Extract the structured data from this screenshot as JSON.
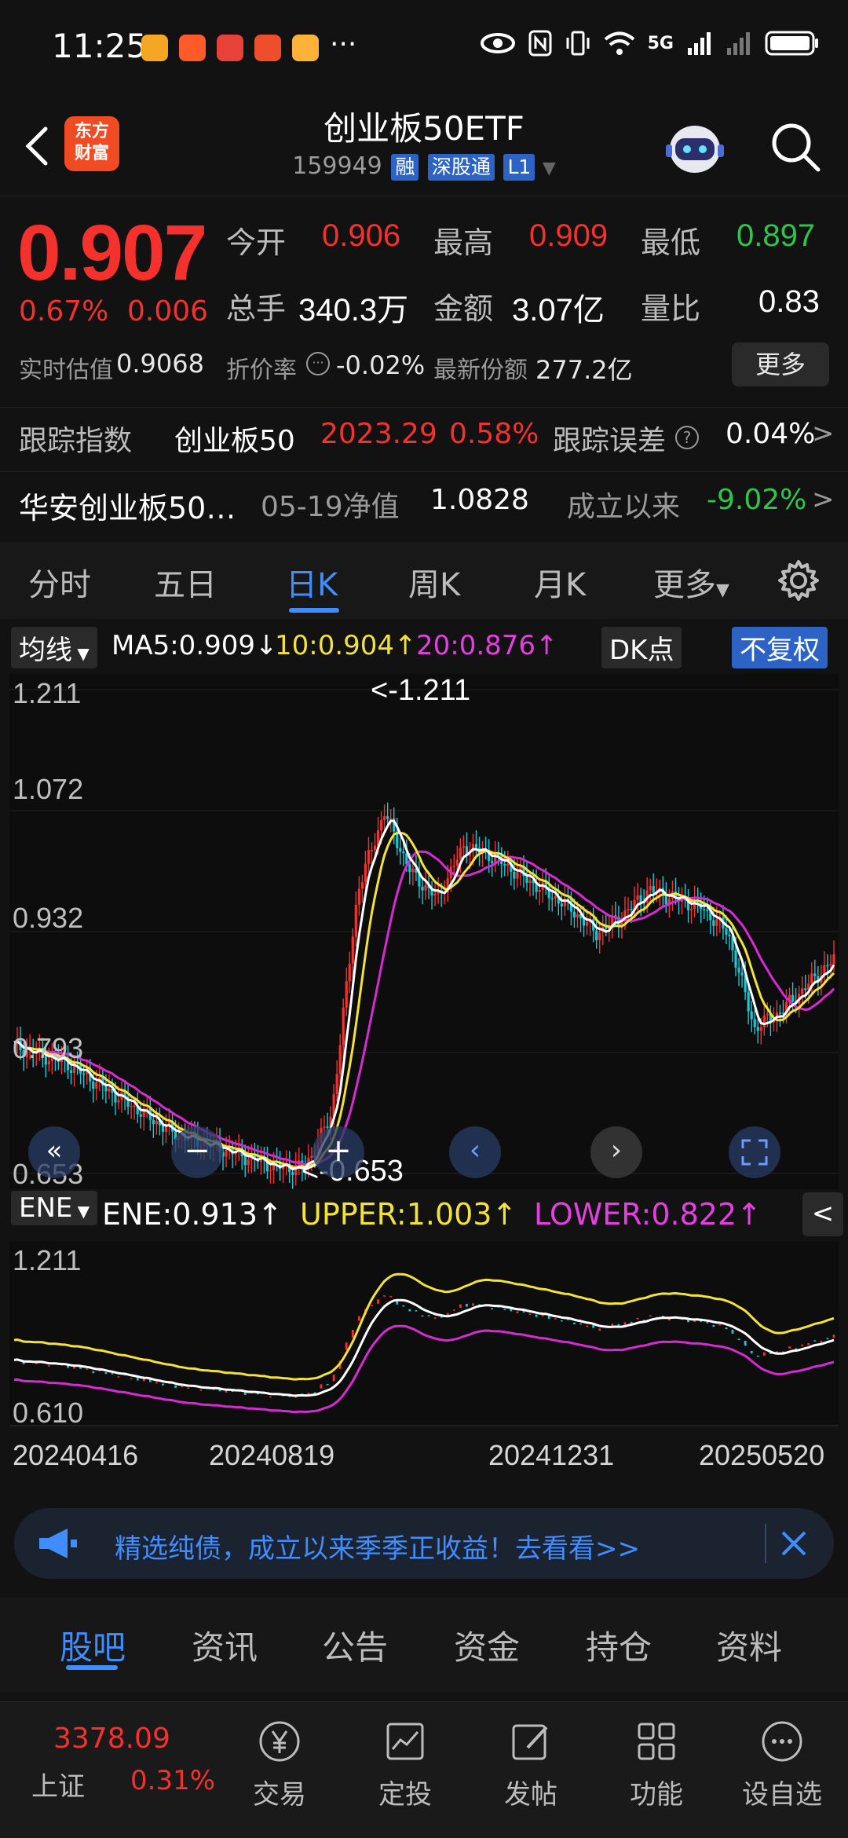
{
  "status": {
    "time": "11:25",
    "network": "5G",
    "more": "···"
  },
  "header": {
    "logo_line1": "东方",
    "logo_line2": "财富",
    "title": "创业板50ETF",
    "code": "159949",
    "tags": [
      "融",
      "深股通",
      "L1"
    ]
  },
  "quote": {
    "price": "0.907",
    "change_pct": "0.67%",
    "change_abs": "0.006",
    "open_label": "今开",
    "open": "0.906",
    "high_label": "最高",
    "high": "0.909",
    "low_label": "最低",
    "low": "0.897",
    "volume_label": "总手",
    "volume": "340.3万",
    "amount_label": "金额",
    "amount": "3.07亿",
    "ratio_label": "量比",
    "ratio": "0.83",
    "iopv_label": "实时估值",
    "iopv": "0.9068",
    "discount_label": "折价率",
    "discount": "-0.02%",
    "shares_label": "最新份额",
    "shares": "277.2亿",
    "more_label": "更多"
  },
  "tracking": {
    "label": "跟踪指数",
    "index_name": "创业板50",
    "index_value": "2023.29",
    "index_pct": "0.58%",
    "error_label": "跟踪误差",
    "error_value": "0.04%"
  },
  "fund": {
    "name": "华安创业板50…",
    "nav_label": "05-19净值",
    "nav": "1.0828",
    "since_label": "成立以来",
    "since_value": "-9.02%"
  },
  "period_tabs": [
    "分时",
    "五日",
    "日K",
    "周K",
    "月K",
    "更多"
  ],
  "indicator": {
    "ma_dropdown": "均线",
    "ma5": "MA5:0.909↓",
    "ma10": "10:0.904↑",
    "ma20": "20:0.876↑",
    "dk_button": "DK点",
    "adjust_button": "不复权",
    "ene_dropdown": "ENE",
    "ene": "ENE:0.913↑",
    "upper": "UPPER:1.003↑",
    "lower": "LOWER:0.822↑"
  },
  "chart_data": {
    "type": "candlestick",
    "y_ticks": [
      "1.211",
      "1.072",
      "0.932",
      "0.793",
      "0.653"
    ],
    "ene_y_ticks": [
      "1.211",
      "0.610"
    ],
    "x_ticks": [
      "20240416",
      "20240819",
      "20241231",
      "20250520"
    ],
    "high_annotation": "<-1.211",
    "low_annotation": "<-0.653",
    "ylim": [
      0.653,
      1.211
    ],
    "close_series": [
      0.8,
      0.79,
      0.78,
      0.76,
      0.74,
      0.72,
      0.7,
      0.69,
      0.68,
      0.67,
      0.66,
      0.66,
      0.72,
      0.98,
      1.07,
      1.0,
      0.97,
      1.03,
      1.02,
      1.0,
      0.98,
      0.96,
      0.93,
      0.95,
      0.98,
      0.97,
      0.96,
      0.93,
      0.82,
      0.84,
      0.87,
      0.9
    ],
    "colors": {
      "ma5": "#ffffff",
      "ma10": "#f2e23a",
      "ma20": "#d62bd3",
      "up": "#f5312e",
      "down": "#19c8d6"
    }
  },
  "banner": {
    "text": "精选纯债，成立以来季季正收益！去看看>>"
  },
  "news_tabs": [
    "股吧",
    "资讯",
    "公告",
    "资金",
    "持仓",
    "资料"
  ],
  "bottom_nav": {
    "index_value": "3378.09",
    "index_name": "上证",
    "index_pct": "0.31%",
    "items": [
      "交易",
      "定投",
      "发帖",
      "功能",
      "设自选"
    ]
  }
}
